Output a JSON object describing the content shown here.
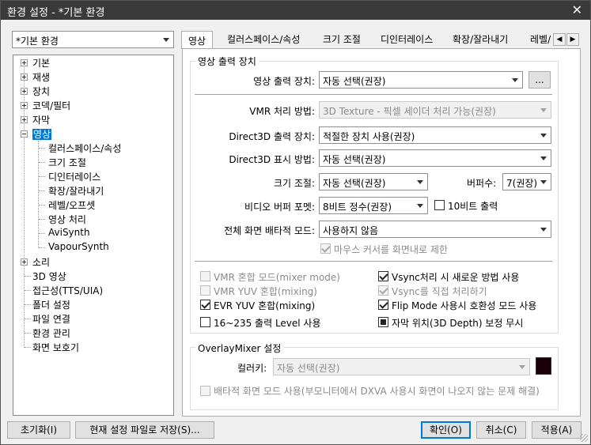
{
  "window": {
    "title": "환경 설정 - *기본 환경",
    "close_symbol": "✕"
  },
  "profile_combo": {
    "value": "*기본 환경"
  },
  "tree": {
    "items": [
      "기본",
      "재생",
      "장치",
      "코덱/필터",
      "자막",
      "영상",
      "소리",
      "3D 영상",
      "접근성(TTS/UIA)",
      "폴더 설정",
      "파일 연결",
      "환경 관리",
      "화면 보호기"
    ],
    "video_children": [
      "컬러스페이스/속성",
      "크기 조절",
      "디인터레이스",
      "확장/잘라내기",
      "레벨/오프셋",
      "영상 처리",
      "AviSynth",
      "VapourSynth"
    ]
  },
  "tabs": [
    "영상",
    "컬러스페이스/속성",
    "크기 조절",
    "디인터레이스",
    "확장/잘라내기",
    "레벨/"
  ],
  "tab_arrows": {
    "left": "◀",
    "right": "▶"
  },
  "output": {
    "group_title": "영상 출력 장치",
    "device_label": "영상 출력 장치:",
    "device_value": "자동 선택(권장)",
    "device_more": "...",
    "vmr_label": "VMR 처리 방법:",
    "vmr_value": "3D Texture - 픽셀 세이더 처리 가능(권장)",
    "d3d_out_label": "Direct3D 출력 장치:",
    "d3d_out_value": "적절한 장치 사용(권장)",
    "d3d_disp_label": "Direct3D 표시 방법:",
    "d3d_disp_value": "자동 선택(권장)",
    "resize_label": "크기 조절:",
    "resize_value": "자동 선택(권장)",
    "buffer_label": "버퍼수:",
    "buffer_value": "7(권장)",
    "vbuf_label": "비디오 버퍼 포멧:",
    "vbuf_value": "8비트 정수(권장)",
    "tenbit_label": "10비트 출력",
    "fse_label": "전체 화면 배타적 모드:",
    "fse_value": "사용하지 않음",
    "mouse_limit": "마우스 커서를 화면내로 제한"
  },
  "options": {
    "vmr_mixer": "VMR 혼합 모드(mixer mode)",
    "vmr_yuv": "VMR YUV 혼합(mixing)",
    "evr_yuv": "EVR YUV 혼합(mixing)",
    "level_16_235": "16~235 출력 Level 사용",
    "vsync_new": "Vsync처리 시 새로운 방법 사용",
    "vsync_direct": "Vsync를 직접 처리하기",
    "flip_mode": "Flip Mode 사용시 호환성 모드 사용",
    "subtitle_pos": "자막 위치(3D Depth) 보정 무시"
  },
  "overlay": {
    "group_title": "OverlayMixer 설정",
    "colorkey_label": "컬러키:",
    "colorkey_value": "자동 선택(권장)",
    "colorkey_swatch": "#1a0008",
    "exclusive_label": "배타적 화면 모드 사용(부모니터에서 DXVA 사용시 화면이 나오지 않는 문제 해결)"
  },
  "buttons": {
    "reset": "초기화(I)",
    "save_current": "현재 설정 파일로 저장(S)...",
    "ok": "확인(O)",
    "cancel": "취소(C)",
    "apply": "적용(A)"
  }
}
